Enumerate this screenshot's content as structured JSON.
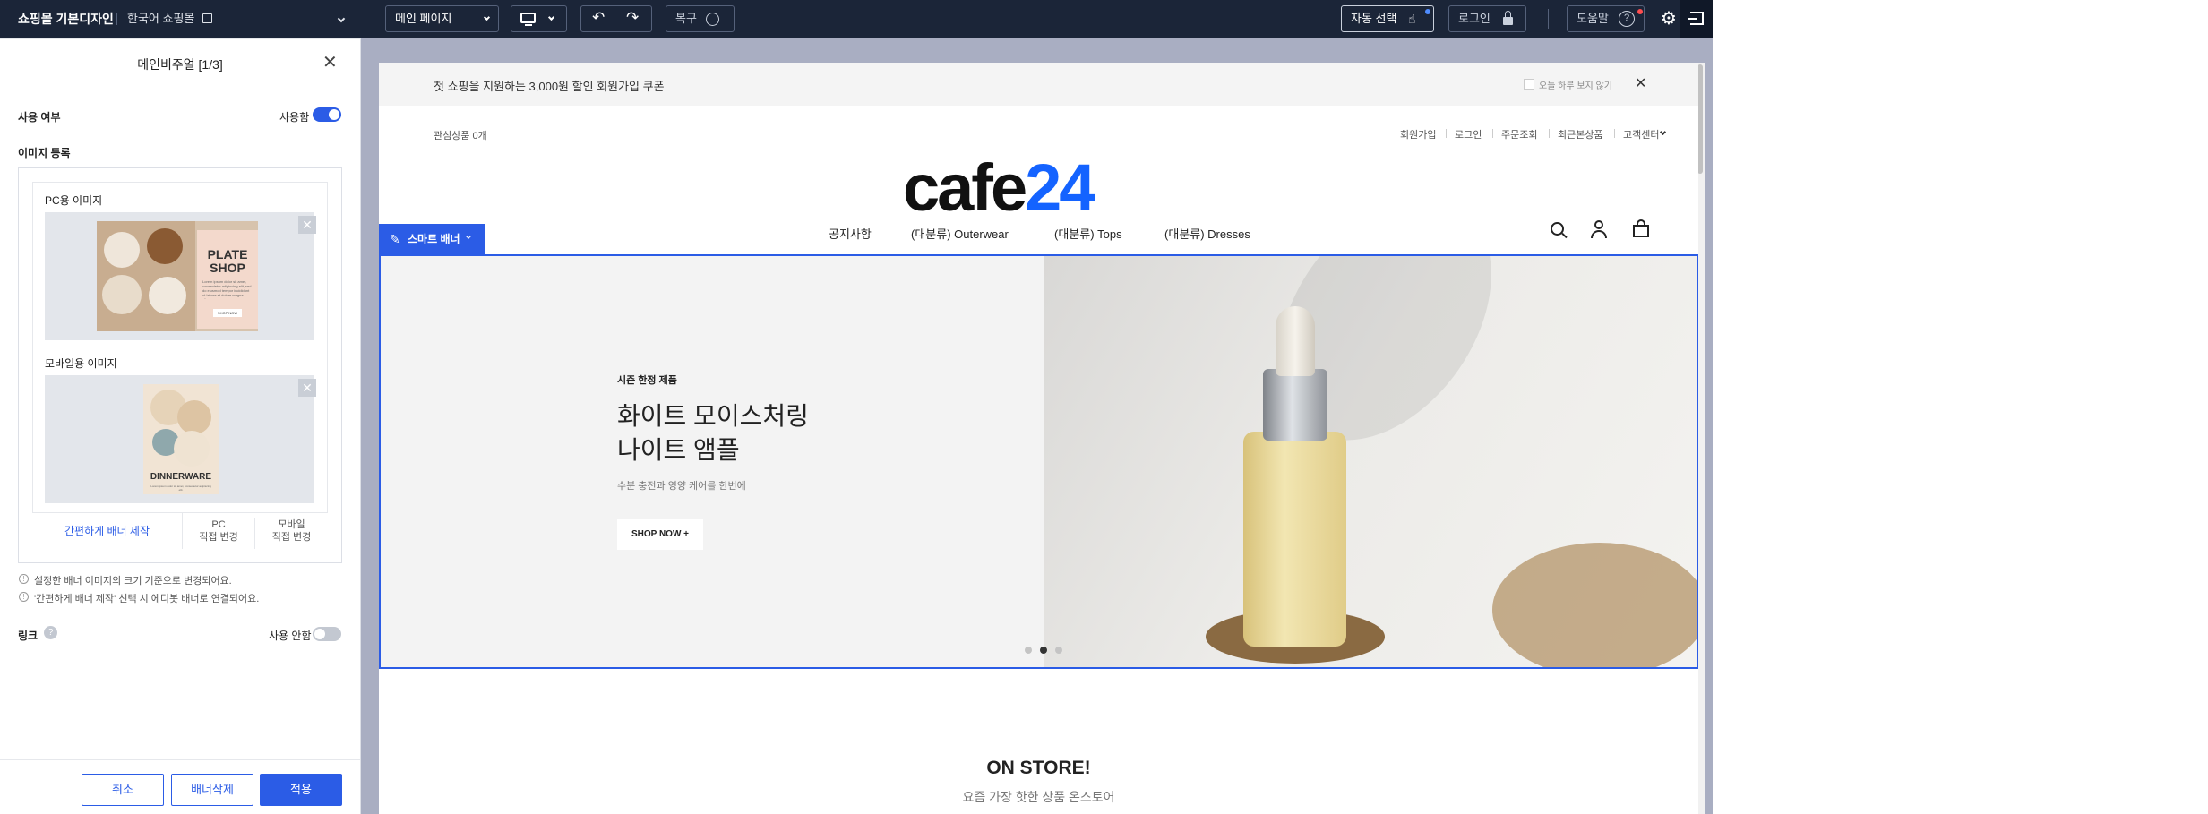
{
  "topbar": {
    "site_name": "쇼핑몰 기본디자인",
    "shop_lang": "한국어 쇼핑몰",
    "page_select": "메인 페이지",
    "restore_label": "복구",
    "auto_select_label": "자동 선택",
    "login_label": "로그인",
    "help_label": "도움말",
    "bg_color": "#1b2538"
  },
  "panel": {
    "title": "메인비주얼 [1/3]",
    "use_label": "사용 여부",
    "use_state": "사용함",
    "image_section": "이미지 등록",
    "pc_image_label": "PC용 이미지",
    "mobile_image_label": "모바일용 이미지",
    "pc_thumb_title": "PLATE SHOP",
    "pc_thumb_caption": "Lorem ipsum dolor sit amet, consectetur adipiscing elit, sed do eiusmod tempor incididunt ut labore et dolore magna aliqua.",
    "pc_thumb_button": "SHOP NOW",
    "mobile_thumb_title": "DINNERWARE",
    "mobile_thumb_caption": "Lorem ipsum dolor sit amet, consectetur adipiscing elit.",
    "easy_banner": "간편하게 배너 제작",
    "pc_direct_1": "PC",
    "pc_direct_2": "직접 변경",
    "mobile_direct_1": "모바일",
    "mobile_direct_2": "직접 변경",
    "note_1": "설정한 배너 이미지의 크기 기준으로 변경되어요.",
    "note_2": "'간편하게 배너 제작' 선택 시 에디봇 배너로 연결되어요.",
    "link_label": "링크",
    "link_state": "사용 안함",
    "cancel": "취소",
    "delete_banner": "배너삭제",
    "apply": "적용",
    "accent_color": "#2b5ce6"
  },
  "store": {
    "promo": "첫 쇼핑을 지원하는 3,000원 할인 회원가입 쿠폰",
    "promo_hide": "오늘 하루 보지 않기",
    "wishlist": "관심상품 0개",
    "util": [
      "회원가입",
      "로그인",
      "주문조회",
      "최근본상품",
      "고객센터"
    ],
    "logo_main": "cafe",
    "logo_num": "24",
    "nav": [
      "공지사항",
      "(대분류) Outerwear",
      "(대분류) Tops",
      "(대분류) Dresses"
    ],
    "smart_banner_tag": "스마트 배너",
    "banner": {
      "eyebrow": "시즌 한정 제품",
      "title_1": "화이트 모이스처링",
      "title_2": "나이트 앰플",
      "subtitle": "수분 충전과 영양 케어를 한번에",
      "cta": "SHOP NOW +"
    },
    "slider_active": 2,
    "section_title": "ON STORE!",
    "section_sub": "요즘 가장 핫한 상품 온스토어"
  }
}
